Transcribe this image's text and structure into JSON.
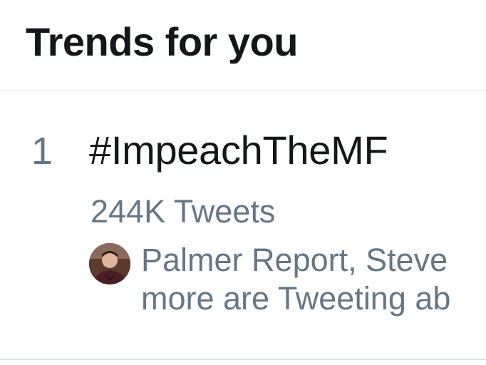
{
  "header": {
    "title": "Trends for you"
  },
  "trend": {
    "rank": "1",
    "hashtag": "#ImpeachTheMF",
    "tweet_count": "244K Tweets",
    "context_line1": "Palmer Report, Steve",
    "context_line2": "more are Tweeting ab"
  },
  "colors": {
    "primary_text": "#14171a",
    "secondary_text": "#657786",
    "divider": "#dde3e8"
  }
}
